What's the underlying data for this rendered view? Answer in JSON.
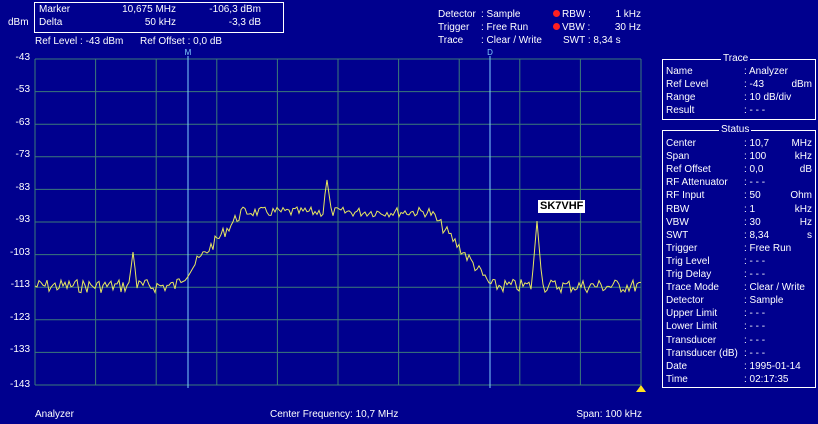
{
  "header": {
    "dbm_unit": "dBm",
    "marker_label": "Marker",
    "marker_freq": "10,675 MHz",
    "marker_level": "-106,3 dBm",
    "delta_label": "Delta",
    "delta_freq": "50 kHz",
    "delta_level": "-3,3 dB",
    "ref_level_label": "Ref Level : -43 dBm",
    "ref_offset_label": "Ref Offset : 0,0 dB",
    "detector_label": "Detector",
    "detector_value": ": Sample",
    "trigger_label": "Trigger",
    "trigger_value": ": Free Run",
    "trace_label": "Trace",
    "trace_value": ": Clear / Write",
    "rbw_label": "RBW :",
    "rbw_value": "1 kHz",
    "vbw_label": "VBW :",
    "vbw_value": "30 Hz",
    "swt_label": "SWT : 8,34 s"
  },
  "plot": {
    "y_ticks": [
      "-43",
      "-53",
      "-63",
      "-73",
      "-83",
      "-93",
      "-103",
      "-113",
      "-123",
      "-133",
      "-143"
    ],
    "marker_tag": "SK7VHF",
    "marker1_symbol": "M",
    "delta_symbol": "D",
    "colors": {
      "trace": "#e8e860",
      "grid": "#3c7a78",
      "marker": "#80d0ff",
      "background": "#00008e"
    }
  },
  "footer": {
    "left": "Analyzer",
    "center": "Center Frequency: 10,7 MHz",
    "right": "Span: 100 kHz"
  },
  "trace_panel": {
    "title": "Trace",
    "rows": [
      {
        "label": "Name",
        "value": ": Analyzer",
        "unit": ""
      },
      {
        "label": "Ref Level",
        "value": ": -43",
        "unit": "dBm"
      },
      {
        "label": "Range",
        "value": ": 10 dB/div",
        "unit": ""
      },
      {
        "label": "Result",
        "value": ": - - -",
        "unit": ""
      }
    ]
  },
  "status_panel": {
    "title": "Status",
    "rows": [
      {
        "label": "Center",
        "value": ": 10,7",
        "unit": "MHz"
      },
      {
        "label": "Span",
        "value": ": 100",
        "unit": "kHz"
      },
      {
        "label": "Ref Offset",
        "value": ": 0,0",
        "unit": "dB"
      },
      {
        "label": "RF Attenuator",
        "value": ": - - -",
        "unit": ""
      },
      {
        "label": "RF Input",
        "value": ": 50",
        "unit": "Ohm"
      },
      {
        "label": "RBW",
        "value": ": 1",
        "unit": "kHz"
      },
      {
        "label": "VBW",
        "value": ": 30",
        "unit": "Hz"
      },
      {
        "label": "SWT",
        "value": ": 8,34",
        "unit": "s"
      },
      {
        "label": "Trigger",
        "value": ": Free Run",
        "unit": ""
      },
      {
        "label": "Trig Level",
        "value": ": - - -",
        "unit": ""
      },
      {
        "label": "Trig Delay",
        "value": ": - - -",
        "unit": ""
      },
      {
        "label": "Trace Mode",
        "value": ": Clear / Write",
        "unit": ""
      },
      {
        "label": "Detector",
        "value": ": Sample",
        "unit": ""
      },
      {
        "label": "Upper Limit",
        "value": ": - - -",
        "unit": ""
      },
      {
        "label": "Lower Limit",
        "value": ": - - -",
        "unit": ""
      },
      {
        "label": "Transducer",
        "value": ": - - -",
        "unit": ""
      },
      {
        "label": "Transducer (dB)",
        "value": ": - - -",
        "unit": ""
      },
      {
        "label": "Date",
        "value": ": 1995-01-14",
        "unit": ""
      },
      {
        "label": "Time",
        "value": ": 02:17:35",
        "unit": ""
      }
    ]
  }
}
